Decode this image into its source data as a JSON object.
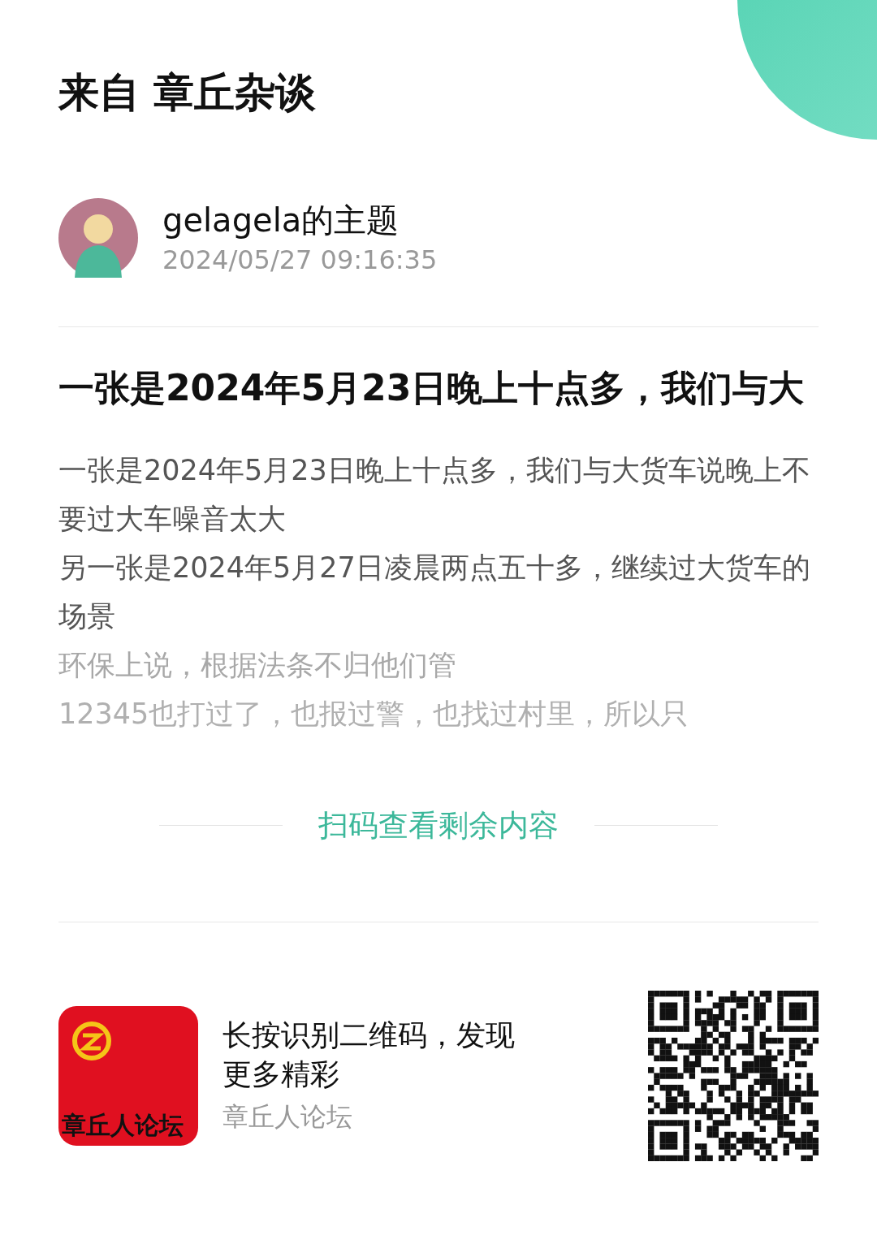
{
  "header": {
    "title": "来自 章丘杂谈"
  },
  "author": {
    "name": "gelagela的主题",
    "time": "2024/05/27 09:16:35"
  },
  "post": {
    "title": "一张是2024年5月23日晚上十点多，我们与大",
    "paragraphs": [
      {
        "text": "一张是2024年5月23日晚上十点多，我们与大货车说晚上不要过大车噪音太大",
        "faded": false
      },
      {
        "text": "另一张是2024年5月27日凌晨两点五十多，继续过大货车的场景",
        "faded": false
      },
      {
        "text": "环保上说，根据法条不归他们管",
        "faded": true
      },
      {
        "text": "12345也打过了，也报过警，也找过村里，所以只",
        "faded": true
      }
    ]
  },
  "more_link": "扫码查看剩余内容",
  "footer": {
    "app_logo_text": "章丘人论坛",
    "prompt": "长按识别二维码，发现更多精彩",
    "app_name": "章丘人论坛"
  }
}
